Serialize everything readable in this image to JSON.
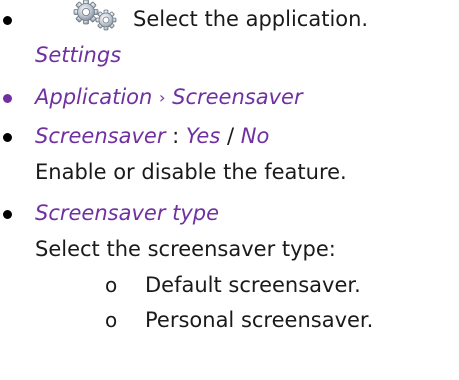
{
  "step1": {
    "icon": "settings-gears-icon",
    "text": "Select the application.",
    "app_name": "Settings"
  },
  "step2": {
    "application": "Application",
    "separator": "›",
    "screensaver": "Screensaver"
  },
  "step3": {
    "setting": "Screensaver",
    "colon": ":",
    "yes": "Yes",
    "slash": "/",
    "no": "No",
    "description": "Enable or disable the feature."
  },
  "step4": {
    "setting": "Screensaver type",
    "description": "Select the screensaver type:",
    "options": [
      "Default screensaver.",
      "Personal screensaver."
    ],
    "sub_bullet": "o"
  },
  "colors": {
    "accent": "#7030a0",
    "text": "#1a1a1a"
  }
}
